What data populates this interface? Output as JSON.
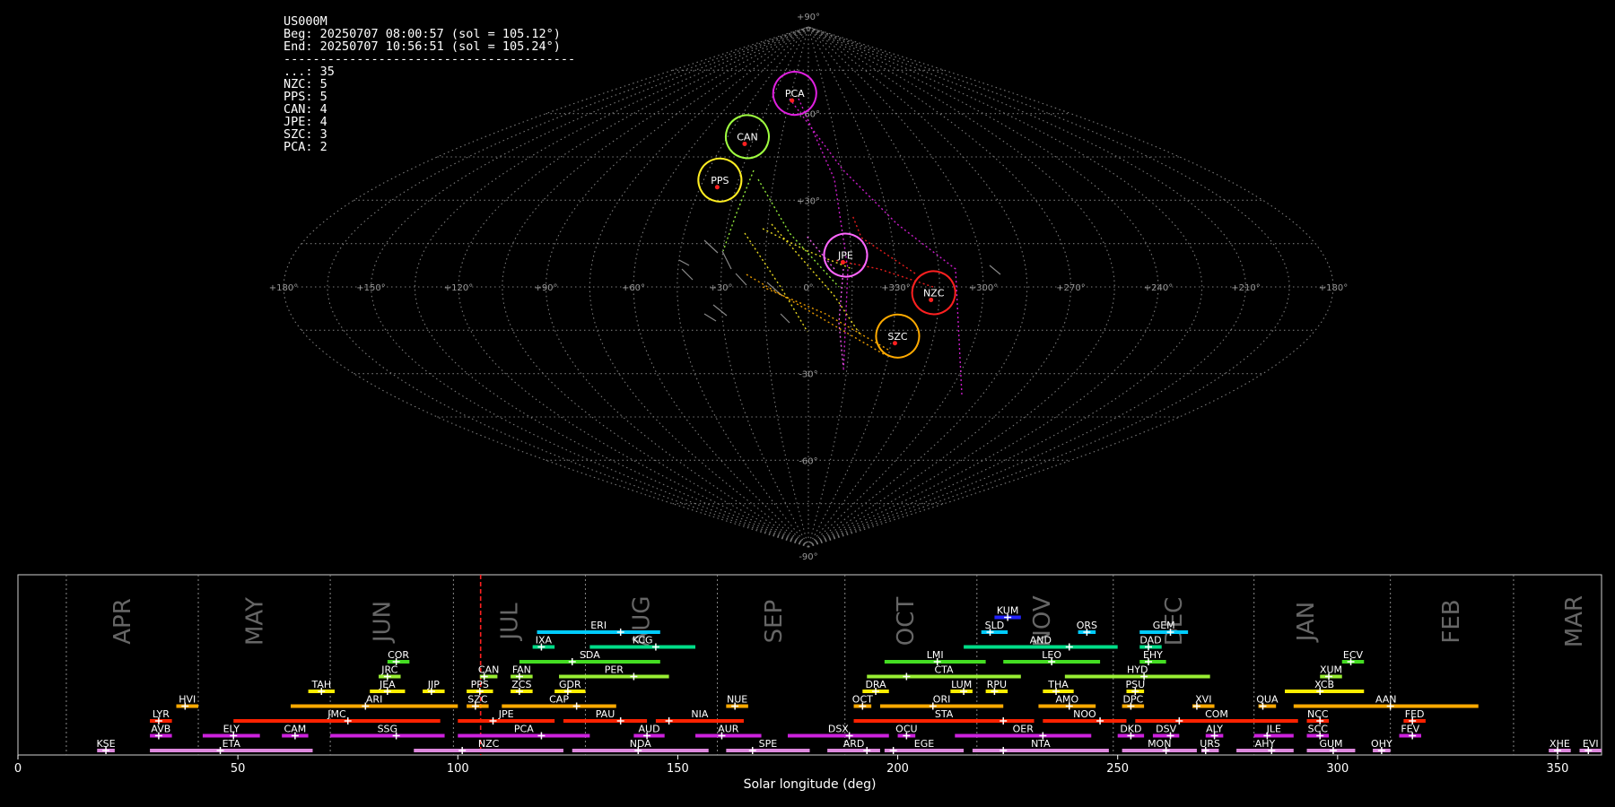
{
  "info": {
    "station": "US000M",
    "begin": "Beg: 20250707 08:00:57 (sol = 105.12°)",
    "end": "End: 20250707 10:56:51 (sol = 105.24°)",
    "separator": "----------------------------------------",
    "counts": [
      "...: 35",
      "NZC: 5",
      "PPS: 5",
      "CAN: 4",
      "JPE: 4",
      "SZC: 3",
      "PCA: 2"
    ]
  },
  "sky_map": {
    "projection": "sinusoidal",
    "center_lon_label": "0",
    "lon_labels": [
      "+180°",
      "+150°",
      "+120°",
      "+90°",
      "+60°",
      "+30°",
      "0°",
      "+330°",
      "+300°",
      "+270°",
      "+240°",
      "+210°",
      "+180°"
    ],
    "lat_labels": [
      "+90°",
      "+60°",
      "+30°",
      "-30°",
      "-60°",
      "-90°"
    ],
    "radiants": [
      {
        "code": "PCA",
        "lon": 12,
        "lat": 67,
        "color": "#e020e0"
      },
      {
        "code": "CAN",
        "lon": 34,
        "lat": 52,
        "color": "#a0ff40"
      },
      {
        "code": "PPS",
        "lon": 38,
        "lat": 37,
        "color": "#ffee22"
      },
      {
        "code": "JPE",
        "lon": -13,
        "lat": 11,
        "color": "#ff66ff"
      },
      {
        "code": "NZC",
        "lon": -43,
        "lat": -2,
        "color": "#ff2020"
      },
      {
        "code": "SZC",
        "lon": -32,
        "lat": -17,
        "color": "#ffaa00"
      }
    ]
  },
  "chart_data": {
    "type": "bar",
    "title": "",
    "xlabel": "Solar longitude (deg)",
    "xlim": [
      0,
      360
    ],
    "x_ticks": [
      0,
      50,
      100,
      150,
      200,
      250,
      300,
      350
    ],
    "current_sol": 105.18,
    "months": [
      {
        "label": "APR",
        "sol": 24
      },
      {
        "label": "MAY",
        "sol": 54
      },
      {
        "label": "JUN",
        "sol": 83
      },
      {
        "label": "JUL",
        "sol": 112
      },
      {
        "label": "AUG",
        "sol": 142
      },
      {
        "label": "SEP",
        "sol": 172
      },
      {
        "label": "OCT",
        "sol": 202
      },
      {
        "label": "NOV",
        "sol": 233
      },
      {
        "label": "DEC",
        "sol": 263
      },
      {
        "label": "JAN",
        "sol": 293
      },
      {
        "label": "FEB",
        "sol": 326
      },
      {
        "label": "MAR",
        "sol": 354
      }
    ],
    "month_boundaries": [
      11,
      41,
      71,
      99,
      129,
      159,
      188,
      218,
      249,
      281,
      312,
      340
    ],
    "showers": [
      {
        "code": "KUM",
        "start": 222,
        "end": 228,
        "peak": 225,
        "row": 10,
        "color": "#2222ff"
      },
      {
        "code": "ERI",
        "start": 118,
        "end": 146,
        "peak": 137,
        "row": 9,
        "color": "#00ccff"
      },
      {
        "code": "SLD",
        "start": 219,
        "end": 225,
        "peak": 221,
        "row": 9,
        "color": "#00ccff"
      },
      {
        "code": "ORS",
        "start": 241,
        "end": 245,
        "peak": 243,
        "row": 9,
        "color": "#00ccff"
      },
      {
        "code": "GEM",
        "start": 255,
        "end": 266,
        "peak": 262,
        "row": 9,
        "color": "#00ccff"
      },
      {
        "code": "IXA",
        "start": 117,
        "end": 122,
        "peak": 119,
        "row": 8,
        "color": "#00dd88"
      },
      {
        "code": "KCG",
        "start": 130,
        "end": 154,
        "peak": 145,
        "row": 8,
        "color": "#00dd88"
      },
      {
        "code": "AND",
        "start": 215,
        "end": 250,
        "peak": 239,
        "row": 8,
        "color": "#00dd88"
      },
      {
        "code": "DAD",
        "start": 255,
        "end": 260,
        "peak": 257,
        "row": 8,
        "color": "#00dd88"
      },
      {
        "code": "COR",
        "start": 84,
        "end": 89,
        "peak": 86,
        "row": 7,
        "color": "#44dd22"
      },
      {
        "code": "SDA",
        "start": 114,
        "end": 146,
        "peak": 126,
        "row": 7,
        "color": "#44dd22"
      },
      {
        "code": "LMI",
        "start": 197,
        "end": 220,
        "peak": 209,
        "row": 7,
        "color": "#44dd22"
      },
      {
        "code": "LEO",
        "start": 224,
        "end": 246,
        "peak": 235,
        "row": 7,
        "color": "#44dd22"
      },
      {
        "code": "EHY",
        "start": 255,
        "end": 261,
        "peak": 257,
        "row": 7,
        "color": "#44dd22"
      },
      {
        "code": "ECV",
        "start": 301,
        "end": 306,
        "peak": 303,
        "row": 7,
        "color": "#44dd22"
      },
      {
        "code": "JRC",
        "start": 82,
        "end": 87,
        "peak": 84,
        "row": 6,
        "color": "#99ee33"
      },
      {
        "code": "CAN",
        "start": 105,
        "end": 109,
        "peak": 106,
        "row": 6,
        "color": "#99ee33"
      },
      {
        "code": "FAN",
        "start": 112,
        "end": 117,
        "peak": 114,
        "row": 6,
        "color": "#99ee33"
      },
      {
        "code": "PER",
        "start": 123,
        "end": 148,
        "peak": 140,
        "row": 6,
        "color": "#99ee33"
      },
      {
        "code": "CTA",
        "start": 193,
        "end": 228,
        "peak": 202,
        "row": 6,
        "color": "#99ee33"
      },
      {
        "code": "HYD",
        "start": 238,
        "end": 271,
        "peak": 256,
        "row": 6,
        "color": "#99ee33"
      },
      {
        "code": "XUM",
        "start": 296,
        "end": 301,
        "peak": 298,
        "row": 6,
        "color": "#99ee33"
      },
      {
        "code": "TAH",
        "start": 66,
        "end": 72,
        "peak": 69,
        "row": 5,
        "color": "#ffee00"
      },
      {
        "code": "JEA",
        "start": 80,
        "end": 88,
        "peak": 84,
        "row": 5,
        "color": "#ffee00"
      },
      {
        "code": "JIP",
        "start": 92,
        "end": 97,
        "peak": 94,
        "row": 5,
        "color": "#ffee00"
      },
      {
        "code": "PPS",
        "start": 102,
        "end": 108,
        "peak": 105,
        "row": 5,
        "color": "#ffee00"
      },
      {
        "code": "ZCS",
        "start": 112,
        "end": 117,
        "peak": 114,
        "row": 5,
        "color": "#ffee00"
      },
      {
        "code": "GDR",
        "start": 122,
        "end": 129,
        "peak": 125,
        "row": 5,
        "color": "#ffee00"
      },
      {
        "code": "DRA",
        "start": 192,
        "end": 198,
        "peak": 195,
        "row": 5,
        "color": "#ffee00"
      },
      {
        "code": "LUM",
        "start": 212,
        "end": 217,
        "peak": 215,
        "row": 5,
        "color": "#ffee00"
      },
      {
        "code": "RPU",
        "start": 220,
        "end": 225,
        "peak": 222,
        "row": 5,
        "color": "#ffee00"
      },
      {
        "code": "THA",
        "start": 233,
        "end": 240,
        "peak": 236,
        "row": 5,
        "color": "#ffee00"
      },
      {
        "code": "PSU",
        "start": 252,
        "end": 256,
        "peak": 254,
        "row": 5,
        "color": "#ffee00"
      },
      {
        "code": "XCB",
        "start": 288,
        "end": 306,
        "peak": 296,
        "row": 5,
        "color": "#ffee00"
      },
      {
        "code": "HVI",
        "start": 36,
        "end": 41,
        "peak": 38,
        "row": 4,
        "color": "#ffaa00"
      },
      {
        "code": "ARI",
        "start": 62,
        "end": 100,
        "peak": 79,
        "row": 4,
        "color": "#ffaa00"
      },
      {
        "code": "SZC",
        "start": 102,
        "end": 107,
        "peak": 104,
        "row": 4,
        "color": "#ffaa00"
      },
      {
        "code": "CAP",
        "start": 110,
        "end": 136,
        "peak": 127,
        "row": 4,
        "color": "#ffaa00"
      },
      {
        "code": "NUE",
        "start": 161,
        "end": 166,
        "peak": 163,
        "row": 4,
        "color": "#ffaa00"
      },
      {
        "code": "OCT",
        "start": 190,
        "end": 194,
        "peak": 192,
        "row": 4,
        "color": "#ffaa00"
      },
      {
        "code": "ORI",
        "start": 196,
        "end": 224,
        "peak": 208,
        "row": 4,
        "color": "#ffaa00"
      },
      {
        "code": "AMO",
        "start": 232,
        "end": 245,
        "peak": 239,
        "row": 4,
        "color": "#ffaa00"
      },
      {
        "code": "DPC",
        "start": 251,
        "end": 256,
        "peak": 253,
        "row": 4,
        "color": "#ffaa00"
      },
      {
        "code": "XVI",
        "start": 267,
        "end": 272,
        "peak": 268,
        "row": 4,
        "color": "#ffaa00"
      },
      {
        "code": "QUA",
        "start": 282,
        "end": 286,
        "peak": 283,
        "row": 4,
        "color": "#ffaa00"
      },
      {
        "code": "AAN",
        "start": 290,
        "end": 332,
        "peak": 312,
        "row": 4,
        "color": "#ffaa00"
      },
      {
        "code": "LYR",
        "start": 30,
        "end": 35,
        "peak": 32,
        "row": 3,
        "color": "#ff2200"
      },
      {
        "code": "JMC",
        "start": 49,
        "end": 96,
        "peak": 75,
        "row": 3,
        "color": "#ff2200"
      },
      {
        "code": "JPE",
        "start": 100,
        "end": 122,
        "peak": 108,
        "row": 3,
        "color": "#ff2200"
      },
      {
        "code": "PAU",
        "start": 124,
        "end": 143,
        "peak": 137,
        "row": 3,
        "color": "#ff2200"
      },
      {
        "code": "NIA",
        "start": 145,
        "end": 165,
        "peak": 148,
        "row": 3,
        "color": "#ff2200"
      },
      {
        "code": "STA",
        "start": 190,
        "end": 231,
        "peak": 224,
        "row": 3,
        "color": "#ff2200"
      },
      {
        "code": "NOO",
        "start": 233,
        "end": 252,
        "peak": 246,
        "row": 3,
        "color": "#ff2200"
      },
      {
        "code": "COM",
        "start": 254,
        "end": 291,
        "peak": 264,
        "row": 3,
        "color": "#ff2200"
      },
      {
        "code": "NCC",
        "start": 293,
        "end": 298,
        "peak": 296,
        "row": 3,
        "color": "#ff2200"
      },
      {
        "code": "FED",
        "start": 315,
        "end": 320,
        "peak": 317,
        "row": 3,
        "color": "#ff2200"
      },
      {
        "code": "AVB",
        "start": 30,
        "end": 35,
        "peak": 32,
        "row": 2,
        "color": "#cc22dd"
      },
      {
        "code": "ELY",
        "start": 42,
        "end": 55,
        "peak": 49,
        "row": 2,
        "color": "#cc22dd"
      },
      {
        "code": "CAM",
        "start": 60,
        "end": 66,
        "peak": 63,
        "row": 2,
        "color": "#cc22dd"
      },
      {
        "code": "SSG",
        "start": 71,
        "end": 97,
        "peak": 86,
        "row": 2,
        "color": "#cc22dd"
      },
      {
        "code": "PCA",
        "start": 100,
        "end": 130,
        "peak": 119,
        "row": 2,
        "color": "#cc22dd"
      },
      {
        "code": "AUD",
        "start": 140,
        "end": 147,
        "peak": 143,
        "row": 2,
        "color": "#cc22dd"
      },
      {
        "code": "AUR",
        "start": 154,
        "end": 169,
        "peak": 160,
        "row": 2,
        "color": "#cc22dd"
      },
      {
        "code": "DSX",
        "start": 175,
        "end": 198,
        "peak": 189,
        "row": 2,
        "color": "#cc22dd"
      },
      {
        "code": "OCU",
        "start": 200,
        "end": 204,
        "peak": 202,
        "row": 2,
        "color": "#cc22dd"
      },
      {
        "code": "OER",
        "start": 213,
        "end": 244,
        "peak": 233,
        "row": 2,
        "color": "#cc22dd"
      },
      {
        "code": "DKD",
        "start": 250,
        "end": 256,
        "peak": 253,
        "row": 2,
        "color": "#cc22dd"
      },
      {
        "code": "DSV",
        "start": 258,
        "end": 264,
        "peak": 262,
        "row": 2,
        "color": "#cc22dd"
      },
      {
        "code": "ALY",
        "start": 270,
        "end": 274,
        "peak": 272,
        "row": 2,
        "color": "#cc22dd"
      },
      {
        "code": "JLE",
        "start": 281,
        "end": 290,
        "peak": 284,
        "row": 2,
        "color": "#cc22dd"
      },
      {
        "code": "SCC",
        "start": 293,
        "end": 298,
        "peak": 296,
        "row": 2,
        "color": "#cc22dd"
      },
      {
        "code": "FEV",
        "start": 314,
        "end": 319,
        "peak": 317,
        "row": 2,
        "color": "#cc22dd"
      },
      {
        "code": "KSE",
        "start": 18,
        "end": 22,
        "peak": 20,
        "row": 1,
        "color": "#dd88dd"
      },
      {
        "code": "ETA",
        "start": 30,
        "end": 67,
        "peak": 46,
        "row": 1,
        "color": "#dd88dd"
      },
      {
        "code": "NZC",
        "start": 90,
        "end": 124,
        "peak": 101,
        "row": 1,
        "color": "#dd88dd"
      },
      {
        "code": "NDA",
        "start": 126,
        "end": 157,
        "peak": 141,
        "row": 1,
        "color": "#dd88dd"
      },
      {
        "code": "SPE",
        "start": 161,
        "end": 180,
        "peak": 167,
        "row": 1,
        "color": "#dd88dd"
      },
      {
        "code": "ARD",
        "start": 184,
        "end": 196,
        "peak": 193,
        "row": 1,
        "color": "#dd88dd"
      },
      {
        "code": "EGE",
        "start": 197,
        "end": 215,
        "peak": 199,
        "row": 1,
        "color": "#dd88dd"
      },
      {
        "code": "NTA",
        "start": 217,
        "end": 248,
        "peak": 224,
        "row": 1,
        "color": "#dd88dd"
      },
      {
        "code": "MON",
        "start": 251,
        "end": 268,
        "peak": 261,
        "row": 1,
        "color": "#dd88dd"
      },
      {
        "code": "URS",
        "start": 269,
        "end": 273,
        "peak": 270,
        "row": 1,
        "color": "#dd88dd"
      },
      {
        "code": "AHY",
        "start": 277,
        "end": 290,
        "peak": 285,
        "row": 1,
        "color": "#dd88dd"
      },
      {
        "code": "GUM",
        "start": 293,
        "end": 304,
        "peak": 299,
        "row": 1,
        "color": "#dd88dd"
      },
      {
        "code": "OHY",
        "start": 308,
        "end": 312,
        "peak": 310,
        "row": 1,
        "color": "#dd88dd"
      },
      {
        "code": "XHE",
        "start": 348,
        "end": 353,
        "peak": 350,
        "row": 1,
        "color": "#dd88dd"
      },
      {
        "code": "EVI",
        "start": 355,
        "end": 360,
        "peak": 357,
        "row": 1,
        "color": "#dd88dd"
      }
    ]
  }
}
